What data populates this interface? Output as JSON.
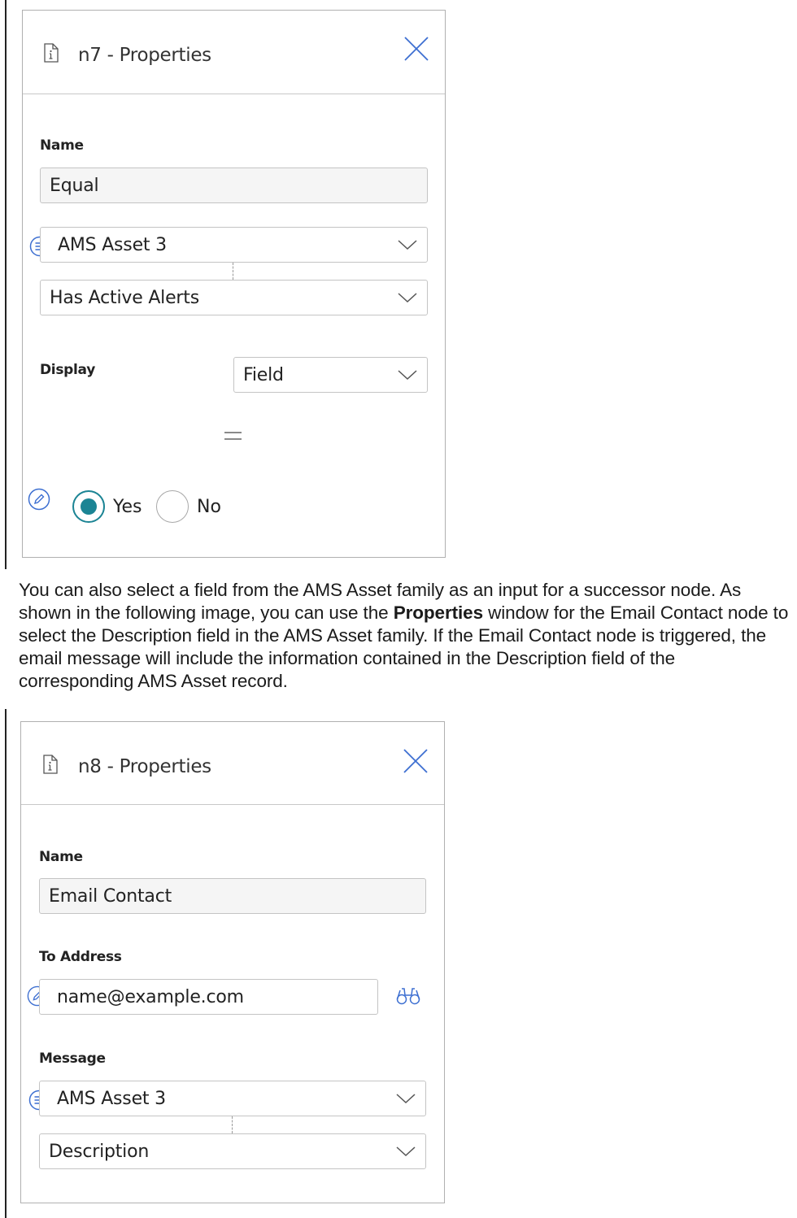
{
  "panel1": {
    "title": "n7 - Properties",
    "name_label": "Name",
    "name_value": "Equal",
    "source_select": "AMS Asset 3",
    "field_select": "Has Active Alerts",
    "display_label": "Display",
    "display_select": "Field",
    "radio_yes": "Yes",
    "radio_no": "No",
    "radio_selected": "Yes"
  },
  "paragraph": {
    "text_before": "You can also select a field from the AMS Asset family as an input for a successor node. As shown in the following image, you can use the ",
    "bold": "Properties",
    "text_after": " window for the Email Contact node to select the Description field in the AMS Asset family. If the Email Contact node is triggered, the email message will include the information contained in the Description field of the corresponding AMS Asset record."
  },
  "panel2": {
    "title": "n8 - Properties",
    "name_label": "Name",
    "name_value": "Email Contact",
    "to_address_label": "To Address",
    "to_address_value": "name@example.com",
    "message_label": "Message",
    "source_select": "AMS Asset 3",
    "field_select": "Description"
  },
  "colors": {
    "accent": "#1b8494",
    "icon_blue": "#3d6fd1",
    "border": "#b0b0b0"
  },
  "icons": [
    "info-document-icon",
    "close-icon",
    "chevron-down-icon",
    "list-icon",
    "edit-pencil-icon",
    "binoculars-icon"
  ]
}
